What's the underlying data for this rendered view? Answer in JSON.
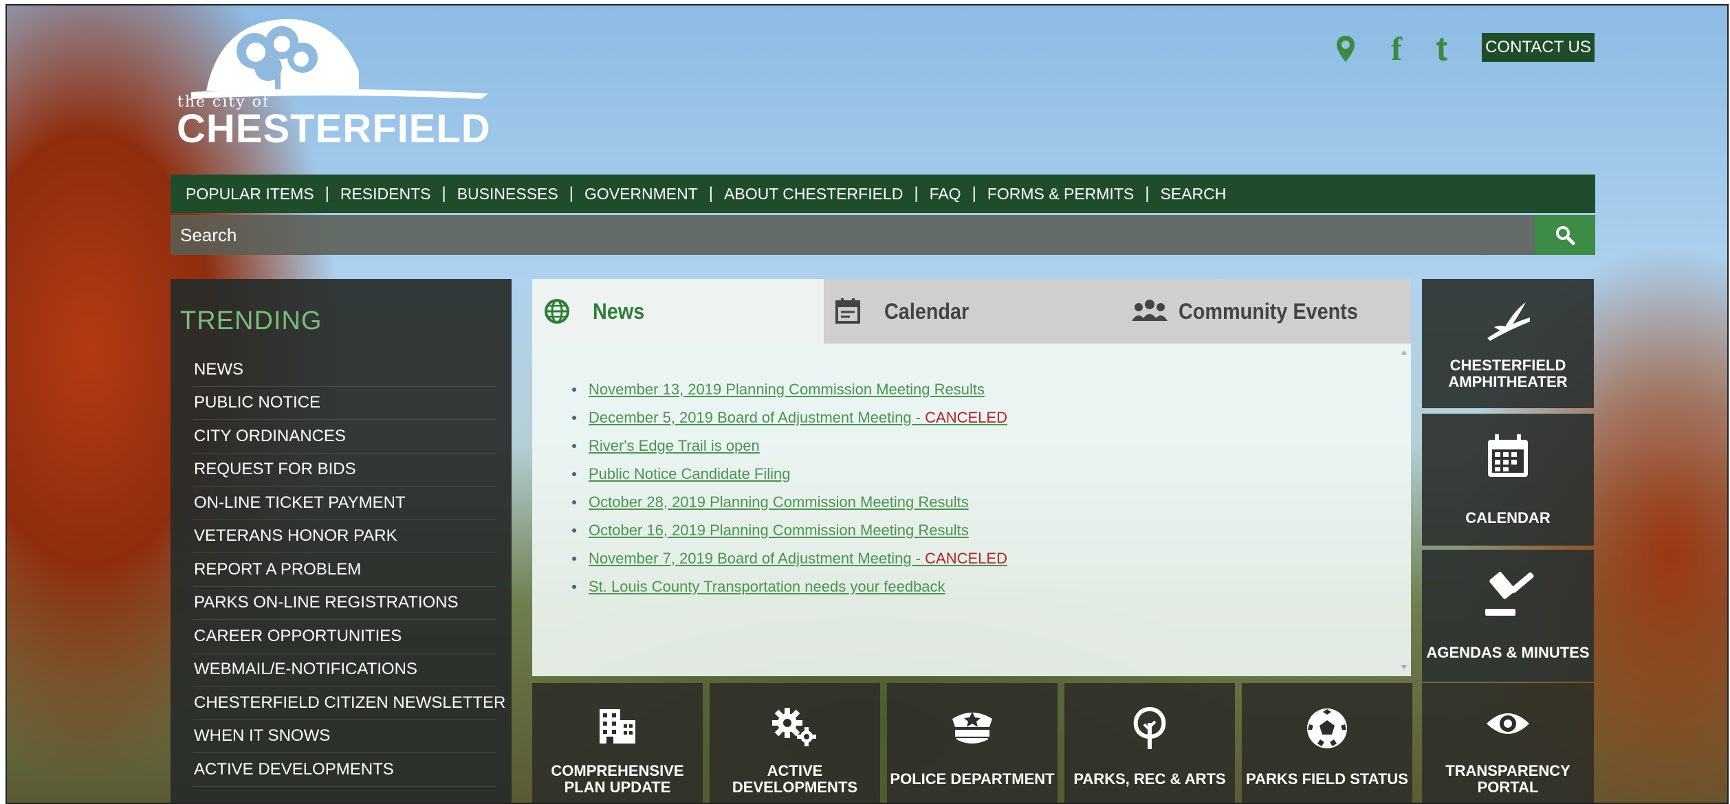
{
  "logo": {
    "small_text": "the city of",
    "big_text": "CHESTERFIELD"
  },
  "header_links": {
    "contact_label": "CONTACT US",
    "icons": [
      "map-pin-icon",
      "facebook-icon",
      "twitter-icon"
    ],
    "facebook_glyph": "f",
    "twitter_glyph": "t"
  },
  "nav": {
    "items": [
      "POPULAR ITEMS",
      "RESIDENTS",
      "BUSINESSES",
      "GOVERNMENT",
      "ABOUT CHESTERFIELD",
      "FAQ",
      "FORMS & PERMITS",
      "SEARCH"
    ],
    "separator": "|"
  },
  "search": {
    "placeholder": "Search"
  },
  "trending": {
    "title": "TRENDING",
    "items": [
      "NEWS",
      "PUBLIC NOTICE",
      "CITY ORDINANCES",
      "REQUEST FOR BIDS",
      "ON-LINE TICKET PAYMENT",
      "VETERANS HONOR PARK",
      "REPORT A PROBLEM",
      "PARKS ON-LINE REGISTRATIONS",
      "CAREER OPPORTUNITIES",
      "WEBMAIL/E-NOTIFICATIONS",
      "CHESTERFIELD CITIZEN NEWSLETTER",
      "WHEN IT SNOWS",
      "ACTIVE DEVELOPMENTS"
    ]
  },
  "tabs": [
    {
      "label": "News",
      "icon": "globe-icon",
      "active": true
    },
    {
      "label": "Calendar",
      "icon": "calendar-icon",
      "active": false
    },
    {
      "label": "Community Events",
      "icon": "people-icon",
      "active": false
    }
  ],
  "news": {
    "items": [
      {
        "text": "November 13, 2019 Planning Commission Meeting Results",
        "suffix": ""
      },
      {
        "text": "December 5, 2019 Board of Adjustment Meeting - ",
        "suffix": "CANCELED"
      },
      {
        "text": "River's Edge Trail is open",
        "suffix": ""
      },
      {
        "text": "Public Notice Candidate Filing",
        "suffix": ""
      },
      {
        "text": "October 28, 2019 Planning Commission Meeting Results",
        "suffix": ""
      },
      {
        "text": "October 16, 2019 Planning Commission Meeting Results",
        "suffix": ""
      },
      {
        "text": "November 7, 2019 Board of Adjustment Meeting - ",
        "suffix": "CANCELED"
      },
      {
        "text": "St. Louis County Transportation needs your feedback",
        "suffix": ""
      }
    ]
  },
  "right_tiles": [
    {
      "line1": "CHESTERFIELD",
      "line2": "AMPHITHEATER",
      "icon": "amphitheater-icon"
    },
    {
      "line1": "CALENDAR",
      "line2": "",
      "icon": "calendar-icon"
    },
    {
      "line1": "AGENDAS & MINUTES",
      "line2": "",
      "icon": "gavel-icon"
    }
  ],
  "bottom_tiles": [
    {
      "line1": "COMPREHENSIVE",
      "line2": "PLAN UPDATE",
      "icon": "building-icon"
    },
    {
      "line1": "ACTIVE",
      "line2": "DEVELOPMENTS",
      "icon": "gears-icon"
    },
    {
      "line1": "POLICE DEPARTMENT",
      "line2": "",
      "icon": "police-badge-icon"
    },
    {
      "line1": "PARKS, REC & ARTS",
      "line2": "",
      "icon": "tree-icon"
    },
    {
      "line1": "PARKS FIELD STATUS",
      "line2": "",
      "icon": "soccer-ball-icon"
    },
    {
      "line1": "TRANSPARENCY",
      "line2": "PORTAL",
      "icon": "eye-icon"
    }
  ],
  "colors": {
    "nav_green": "#1f4d2c",
    "accent_green": "#3c8c47",
    "link_green": "#4a9450",
    "canceled_red": "#b0252b",
    "trending_title": "#7dbb7a"
  }
}
